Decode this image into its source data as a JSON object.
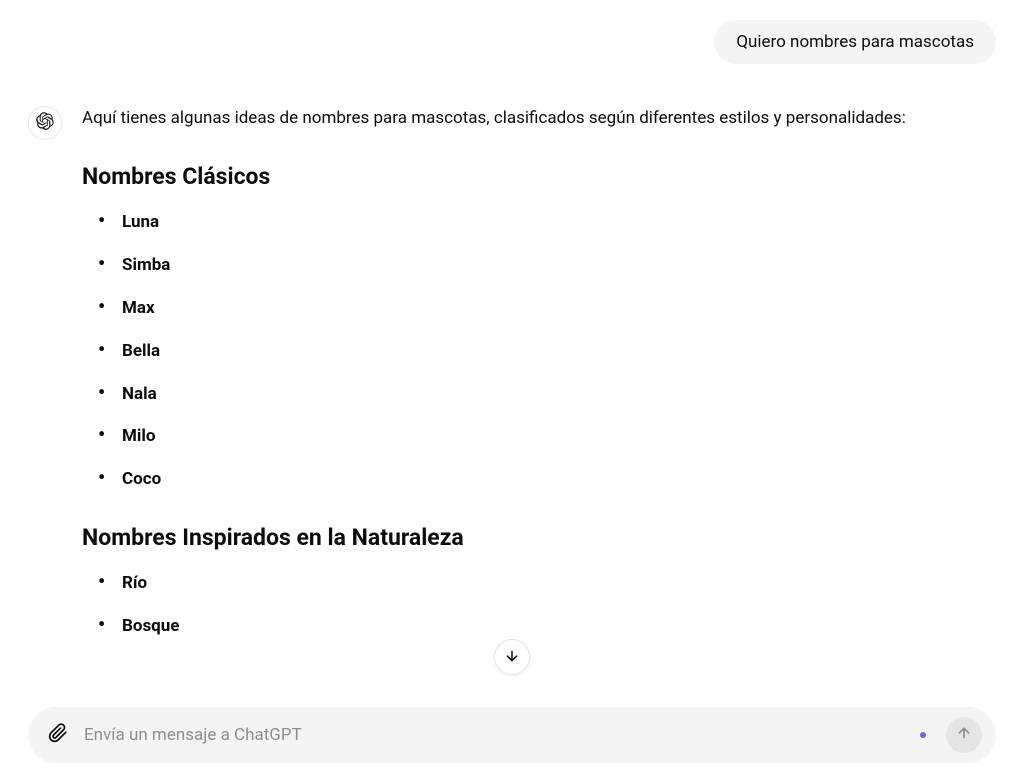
{
  "user_message": "Quiero nombres para mascotas",
  "assistant": {
    "intro": "Aquí tienes algunas ideas de nombres para mascotas, clasificados según diferentes estilos y personalidades:",
    "sections": [
      {
        "heading": "Nombres Clásicos",
        "items": [
          "Luna",
          "Simba",
          "Max",
          "Bella",
          "Nala",
          "Milo",
          "Coco"
        ]
      },
      {
        "heading": "Nombres Inspirados en la Naturaleza",
        "items": [
          "Río",
          "Bosque"
        ]
      }
    ]
  },
  "composer": {
    "placeholder": "Envía un mensaje a ChatGPT"
  }
}
